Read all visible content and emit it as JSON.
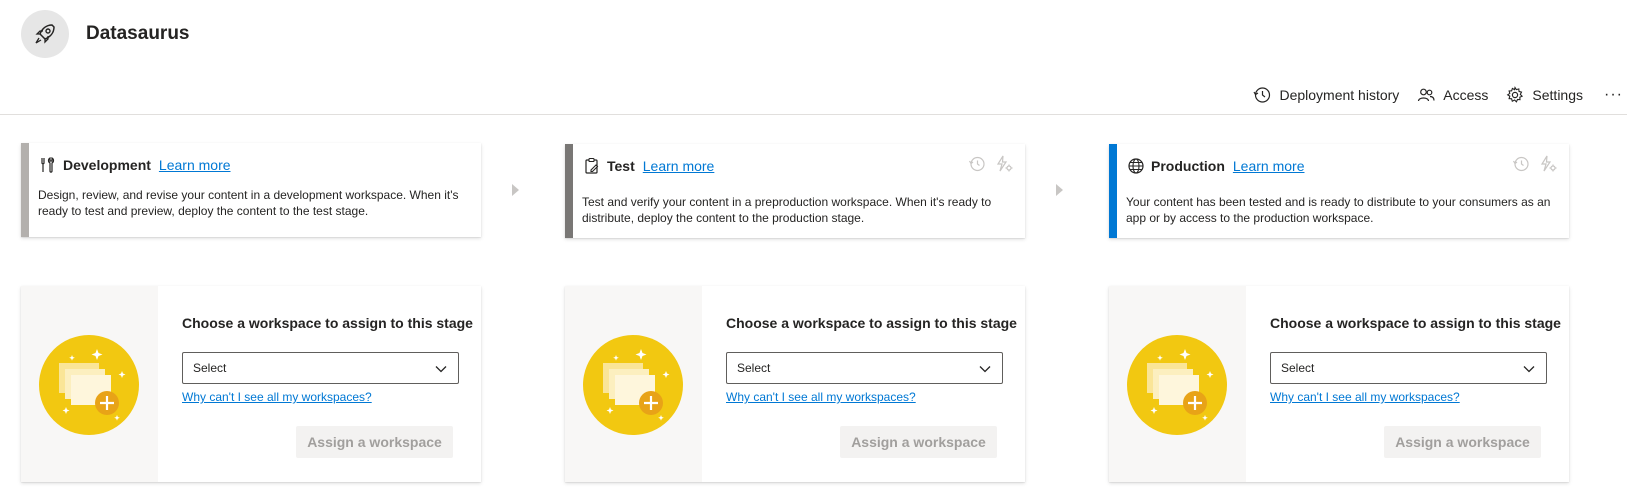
{
  "app": {
    "title": "Datasaurus",
    "logo_icon": "rocket-icon"
  },
  "toolbar": {
    "history_label": "Deployment history",
    "access_label": "Access",
    "settings_label": "Settings",
    "more_label": "···"
  },
  "stages": [
    {
      "name": "Development",
      "learn_more": "Learn more",
      "description": "Design, review, and revise your content in a development workspace. When it's ready to test and preview, deploy the content to the test stage.",
      "accent_color": "#b3b0ad",
      "icon": "wrench-icon"
    },
    {
      "name": "Test",
      "learn_more": "Learn more",
      "description": "Test and verify your content in a preproduction workspace. When it's ready to distribute, deploy the content to the production stage.",
      "accent_color": "#797775",
      "icon": "clipboard-icon"
    },
    {
      "name": "Production",
      "learn_more": "Learn more",
      "description": "Your content has been tested and is ready to distribute to your consumers as an app or by access to the production workspace.",
      "accent_color": "#0078d4",
      "icon": "globe-icon"
    }
  ],
  "assign": {
    "title": "Choose a workspace to assign to this stage",
    "select_value": "Select",
    "why_link": "Why can't I see all my workspaces?",
    "button_label": "Assign a workspace"
  },
  "colors": {
    "link": "#0078d4",
    "illustration": "#f2c811"
  }
}
